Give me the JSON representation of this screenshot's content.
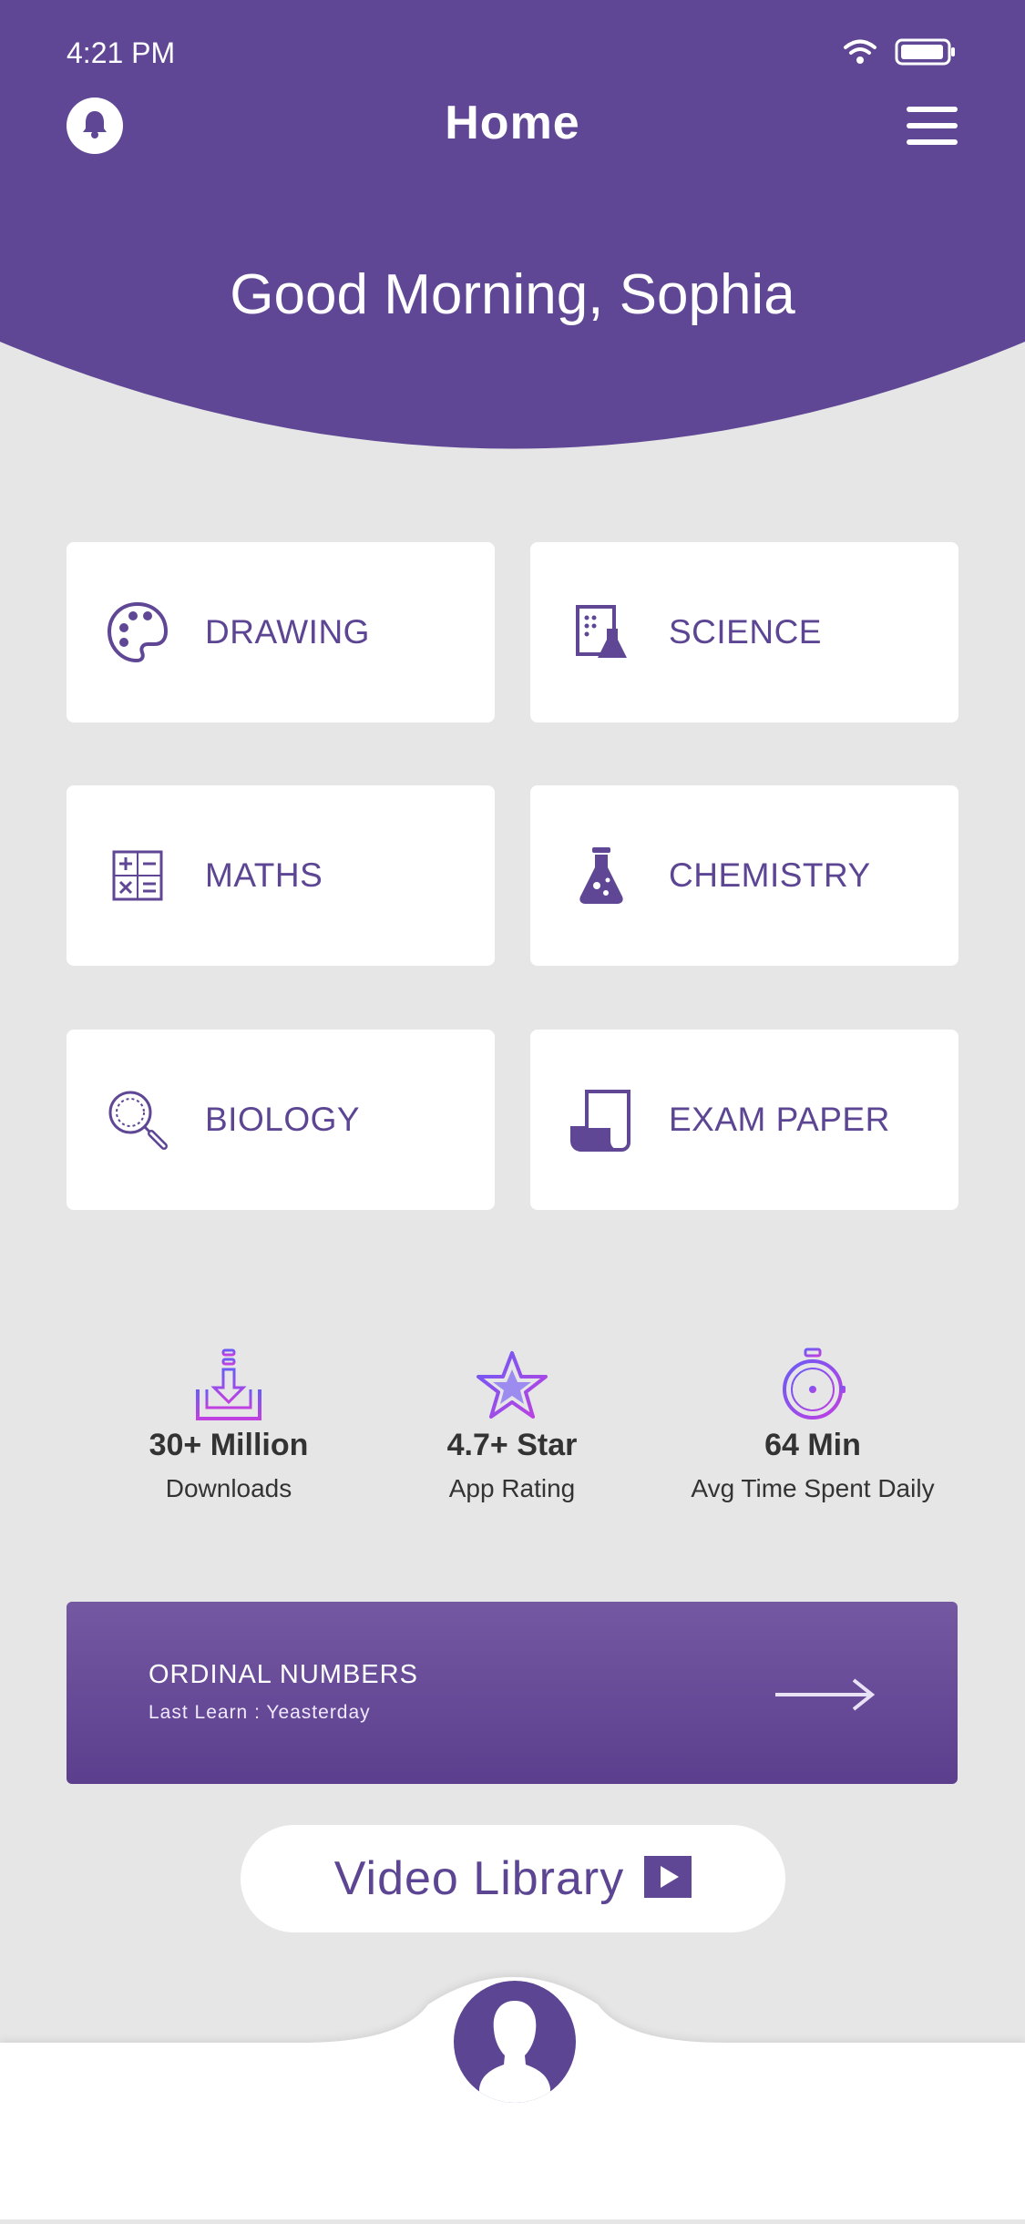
{
  "status_bar": {
    "time": "4:21 PM"
  },
  "header": {
    "title": "Home",
    "greeting": "Good Morning, Sophia"
  },
  "subjects": [
    {
      "label": "DRAWING",
      "icon": "palette-icon"
    },
    {
      "label": "SCIENCE",
      "icon": "science-icon"
    },
    {
      "label": "MATHS",
      "icon": "calculator-icon"
    },
    {
      "label": "CHEMISTRY",
      "icon": "flask-icon"
    },
    {
      "label": "BIOLOGY",
      "icon": "magnifier-icon"
    },
    {
      "label": "EXAM PAPER",
      "icon": "paper-icon"
    }
  ],
  "stats": [
    {
      "value": "30+ Million",
      "caption": "Downloads",
      "icon": "download-icon"
    },
    {
      "value": "4.7+ Star",
      "caption": "App Rating",
      "icon": "star-icon"
    },
    {
      "value": "64 Min",
      "caption": "Avg Time Spent Daily",
      "icon": "stopwatch-icon"
    }
  ],
  "banner": {
    "title": "ORDINAL NUMBERS",
    "subtitle": "Last Learn : Yeasterday"
  },
  "video_button": {
    "label": "Video Library"
  },
  "colors": {
    "primary": "#5f4795",
    "background": "#e6e6e6",
    "text_dark": "#333333"
  }
}
